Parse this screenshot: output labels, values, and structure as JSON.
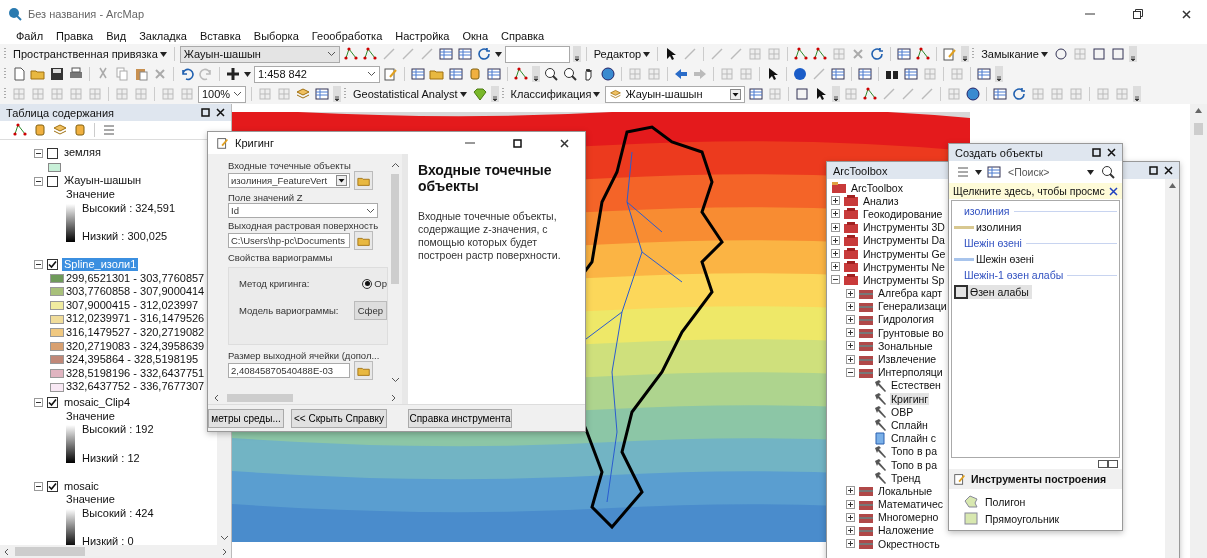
{
  "window": {
    "title": "Без названия - ArcMap"
  },
  "menu": [
    "Файл",
    "Правка",
    "Вид",
    "Закладка",
    "Вставка",
    "Выборка",
    "Геообработка",
    "Настройка",
    "Окна",
    "Справка"
  ],
  "toolbars": {
    "georef_label": "Пространственная привязка",
    "georef_layer": "Жауын-шашын",
    "editor": "Редактор",
    "snapping": "Замыкание",
    "scale": "1:458 842",
    "zoom_percent": "100%",
    "geostat": "Geostatistical Analyst",
    "classification": "Классификация",
    "class_layer": "Жауын-шашын"
  },
  "toc": {
    "title": "Таблица содержания",
    "layers": [
      {
        "name": "земляя",
        "checked": false,
        "selected": false,
        "kind": "swatch"
      },
      {
        "name": "Жауын-шашын",
        "checked": false,
        "selected": false,
        "kind": "stretch",
        "field": "Значение",
        "high": "Высокий : 324,591",
        "low": "Низкий : 300,025"
      },
      {
        "name": "Spline_изоли1",
        "checked": true,
        "selected": true,
        "kind": "classes",
        "classes": [
          {
            "label": "299,6521301 - 303,7760857",
            "color": "#6e9a5a"
          },
          {
            "label": "303,7760858 - 307,9000414",
            "color": "#a8c07a"
          },
          {
            "label": "307,9000415 - 312,023997",
            "color": "#f0eca0"
          },
          {
            "label": "312,0239971 - 316,1479526",
            "color": "#f0dc9a"
          },
          {
            "label": "316,1479527 - 320,2719082",
            "color": "#f0c880"
          },
          {
            "label": "320,2719083 - 324,3958639",
            "color": "#d8a070"
          },
          {
            "label": "324,395864 - 328,5198195",
            "color": "#c08878"
          },
          {
            "label": "328,5198196 - 332,6437751",
            "color": "#e0b4c0"
          },
          {
            "label": "332,6437752 - 336,7677307",
            "color": "#f8e8f4"
          }
        ]
      },
      {
        "name": "mosaic_Clip4",
        "checked": true,
        "selected": false,
        "kind": "stretch",
        "field": "Значение",
        "high": "Высокий : 192",
        "low": "Низкий : 12"
      },
      {
        "name": "mosaic",
        "checked": true,
        "selected": false,
        "kind": "stretch",
        "field": "Значение",
        "high": "Высокий : 424",
        "low": "Низкий : 0"
      }
    ]
  },
  "kriging": {
    "title": "Кригинг",
    "fields": [
      {
        "label": "Входные точечные объекты",
        "value": "изолиния_FeatureVert",
        "kind": "dropdown",
        "browse": true
      },
      {
        "label": "Поле значений Z",
        "value": "Id",
        "kind": "combo",
        "browse": false
      },
      {
        "label": "Выходная растровая поверхность",
        "value": "C:\\Users\\hp-pc\\Documents",
        "kind": "text",
        "browse": true
      }
    ],
    "group_label": "Свойства вариограммы",
    "method_label": "Метод кригинга:",
    "method_option": {
      "label": "Ор",
      "selected": true
    },
    "model_label": "Модель вариограммы:",
    "model_value": "Сфер",
    "cell_size": {
      "label": "Размер выходной ячейки (допол...",
      "value": "2,40845870540488E-03"
    },
    "buttons": [
      "метры среды...",
      "<< Скрыть Справку",
      "Справка инструмента"
    ],
    "help_title": "Входные точечные объекты",
    "help_text": "Входные точечные объекты, содержащие z-значения, с помощью которых будет построен растр поверхности."
  },
  "toolbox": {
    "title": "ArcToolbox",
    "root": "ArcToolbox",
    "items": [
      {
        "name": "Анализ",
        "kind": "toolbox",
        "expanded": false,
        "selected": false
      },
      {
        "name": "Геокодирование",
        "kind": "toolbox",
        "expanded": false,
        "selected": false
      },
      {
        "name": "Инструменты 3D",
        "kind": "toolbox",
        "expanded": false,
        "selected": false
      },
      {
        "name": "Инструменты Da",
        "kind": "toolbox",
        "expanded": false,
        "selected": false
      },
      {
        "name": "Инструменты Ge",
        "kind": "toolbox",
        "expanded": false,
        "selected": false
      },
      {
        "name": "Инструменты Ne",
        "kind": "toolbox",
        "expanded": false,
        "selected": false
      },
      {
        "name": "Инструменты Sp",
        "kind": "toolbox",
        "expanded": true,
        "selected": false,
        "children": [
          {
            "name": "Алгебра карт",
            "kind": "toolset",
            "expanded": false,
            "selected": false
          },
          {
            "name": "Генерализаци",
            "kind": "toolset",
            "expanded": false,
            "selected": false
          },
          {
            "name": "Гидрология",
            "kind": "toolset",
            "expanded": false,
            "selected": false
          },
          {
            "name": "Грунтовые во",
            "kind": "toolset",
            "expanded": false,
            "selected": false
          },
          {
            "name": "Зональные",
            "kind": "toolset",
            "expanded": false,
            "selected": false
          },
          {
            "name": "Извлечение",
            "kind": "toolset",
            "expanded": false,
            "selected": false
          },
          {
            "name": "Интерполяци",
            "kind": "toolset",
            "expanded": true,
            "selected": false,
            "children": [
              {
                "name": "Естествен",
                "kind": "tool",
                "selected": false
              },
              {
                "name": "Кригинг",
                "kind": "tool",
                "selected": true
              },
              {
                "name": "ОВР",
                "kind": "tool",
                "selected": false
              },
              {
                "name": "Сплайн",
                "kind": "tool",
                "selected": false
              },
              {
                "name": "Сплайн с",
                "kind": "script",
                "selected": false
              },
              {
                "name": "Топо в ра",
                "kind": "tool",
                "selected": false
              },
              {
                "name": "Топо в ра",
                "kind": "tool",
                "selected": false
              },
              {
                "name": "Тренд",
                "kind": "tool",
                "selected": false
              }
            ]
          },
          {
            "name": "Локальные",
            "kind": "toolset",
            "expanded": false,
            "selected": false
          },
          {
            "name": "Математичес",
            "kind": "toolset",
            "expanded": false,
            "selected": false
          },
          {
            "name": "Многомерно",
            "kind": "toolset",
            "expanded": false,
            "selected": false
          },
          {
            "name": "Наложение",
            "kind": "toolset",
            "expanded": false,
            "selected": false
          },
          {
            "name": "Окрестность",
            "kind": "toolset",
            "expanded": false,
            "selected": false
          }
        ]
      }
    ]
  },
  "create_features": {
    "title": "Создать объекты",
    "search": {
      "placeholder": "<Поиск>"
    },
    "hint": "Щелкните здесь, чтобы просмс",
    "groups": [
      {
        "name": "изолиния",
        "templates": [
          {
            "name": "изолиния",
            "kind": "line",
            "color": "#d8c890",
            "selected": false
          }
        ]
      },
      {
        "name": "Шежін өзені",
        "templates": [
          {
            "name": "Шежін өзені",
            "kind": "line",
            "color": "#a8c4ec",
            "selected": false
          }
        ]
      },
      {
        "name": "Шежін-1 өзен алабы",
        "templates": [
          {
            "name": "Өзен алабы",
            "kind": "polygon",
            "color": "#303030",
            "selected": true
          }
        ]
      }
    ],
    "tools_title": "Инструменты построения",
    "tools": [
      {
        "name": "Полигон",
        "kind": "polygon"
      },
      {
        "name": "Прямоугольник",
        "kind": "rectangle"
      }
    ]
  }
}
